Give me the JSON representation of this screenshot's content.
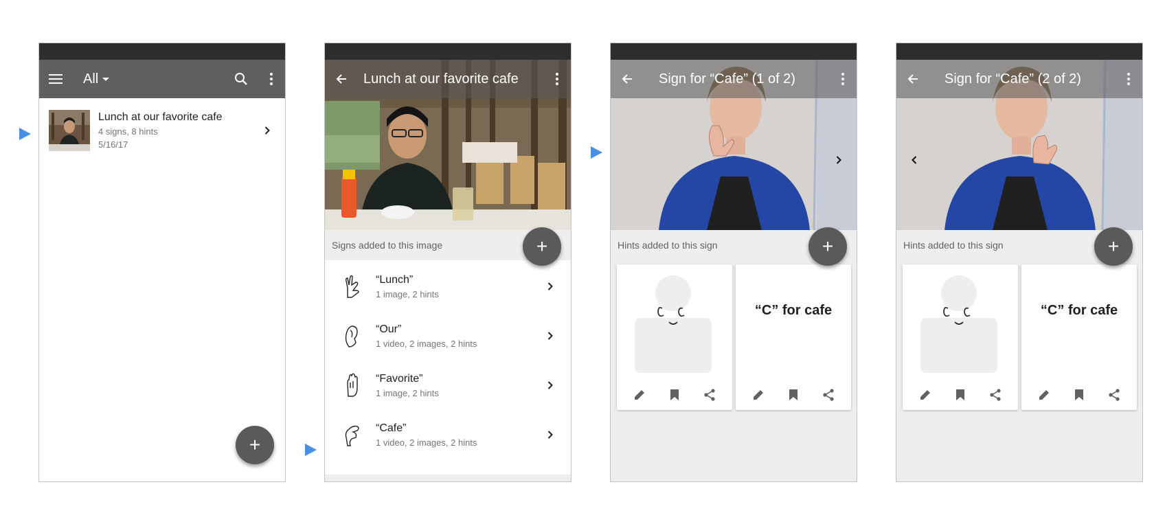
{
  "colors": {
    "app_bar": "#5f5f5f",
    "status_bar": "#2e2e2e",
    "fab": "#5a5a5a",
    "marker": "#4a90e2",
    "section_bg": "#eeeeee"
  },
  "screen1": {
    "filter_label": "All",
    "album": {
      "title": "Lunch at our favorite cafe",
      "summary": "4 signs, 8 hints",
      "date": "5/16/17"
    },
    "fab_label": "+"
  },
  "screen2": {
    "title": "Lunch at our favorite cafe",
    "section_header": "Signs added to this image",
    "fab_label": "+",
    "signs": [
      {
        "title": "“Lunch”",
        "summary": "1 image, 2 hints"
      },
      {
        "title": "“Our”",
        "summary": "1 video, 2 images, 2 hints"
      },
      {
        "title": "“Favorite”",
        "summary": "1 image, 2 hints"
      },
      {
        "title": "“Cafe”",
        "summary": "1 video, 2 images, 2 hints"
      }
    ]
  },
  "screen3": {
    "title": "Sign for “Cafe” (1 of 2)",
    "section_header": "Hints added to this sign",
    "fab_label": "+",
    "text_hint": "“C” for cafe"
  },
  "screen4": {
    "title": "Sign for “Cafe” (2 of 2)",
    "section_header": "Hints added to this sign",
    "fab_label": "+",
    "text_hint": "“C” for cafe"
  }
}
